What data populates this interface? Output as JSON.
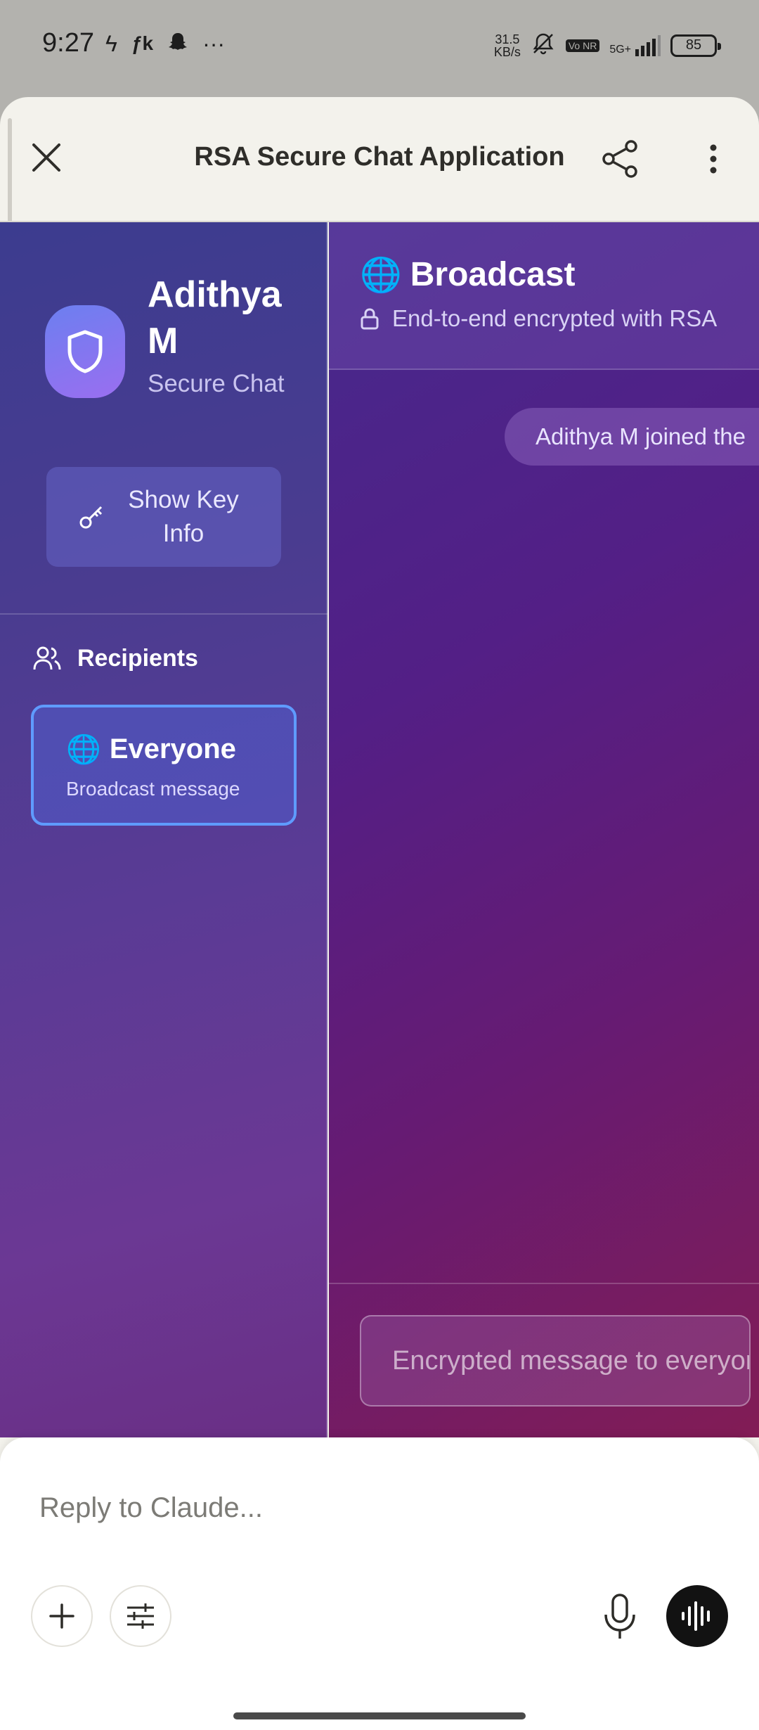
{
  "status_bar": {
    "time": "9:27",
    "left_icons": [
      "flash-icon",
      "fk-icon",
      "snapchat-icon",
      "more-dots-icon"
    ],
    "network_speed_value": "31.5",
    "network_speed_unit": "KB/s",
    "vonr_label": "Vo NR",
    "network_type": "5G+",
    "battery": "85"
  },
  "header": {
    "title": "RSA Secure Chat Application",
    "close_icon": "close-icon",
    "share_icon": "share-icon",
    "more_icon": "more-vertical-icon"
  },
  "sidebar": {
    "user_name": "Adithya M",
    "user_subtitle": "Secure Chat",
    "key_button_label": "Show Key Info",
    "recipients_label": "Recipients",
    "recipients": [
      {
        "icon": "🌐",
        "name": "Everyone",
        "subtitle": "Broadcast message",
        "selected": true
      }
    ]
  },
  "chat": {
    "title_icon": "🌐",
    "title": "Broadcast",
    "subtitle": "End-to-end encrypted with RSA",
    "messages": [
      {
        "type": "system",
        "text": "Adithya M joined the"
      }
    ],
    "input_placeholder": "Encrypted message to everyone..."
  },
  "reply": {
    "placeholder": "Reply to Claude..."
  },
  "colors": {
    "accent": "#5f9bff",
    "sheet_bg": "#f3f2ec",
    "voice_button": "#121212"
  }
}
